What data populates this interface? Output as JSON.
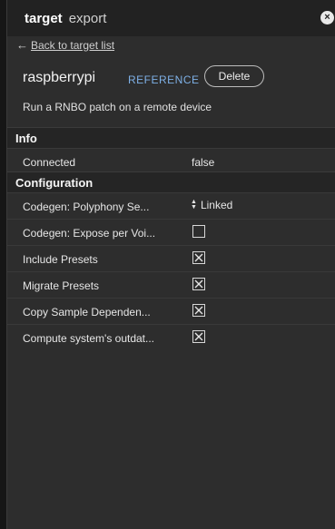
{
  "window": {
    "title_strong": "target",
    "title_light": "export",
    "close_glyph": "×"
  },
  "nav": {
    "back_arrow": "←",
    "back_label": "Back to target list"
  },
  "target": {
    "name": "raspberrypi",
    "reference_label": "REFERENCE",
    "delete_label": "Delete",
    "description": "Run a RNBO patch on a remote device"
  },
  "info": {
    "heading": "Info",
    "rows": [
      {
        "label": "Connected",
        "value": "false"
      }
    ]
  },
  "configuration": {
    "heading": "Configuration",
    "polyphony": {
      "label": "Codegen: Polyphony Se...",
      "value": "Linked"
    },
    "checkboxes": [
      {
        "label": "Codegen: Expose per Voi...",
        "checked": false
      },
      {
        "label": "Include Presets",
        "checked": true
      },
      {
        "label": "Migrate Presets",
        "checked": true
      },
      {
        "label": "Copy Sample Dependen...",
        "checked": true
      },
      {
        "label": "Compute system's outdat...",
        "checked": true
      }
    ]
  },
  "colors": {
    "accent_reference": "#7eb0e6",
    "panel_bg": "#2d2d2d",
    "titlebar_bg": "#222222"
  },
  "icons": [
    "close-icon",
    "arrow-left-icon",
    "sort-arrows-icon",
    "checkbox-checked-icon",
    "checkbox-empty-icon"
  ]
}
